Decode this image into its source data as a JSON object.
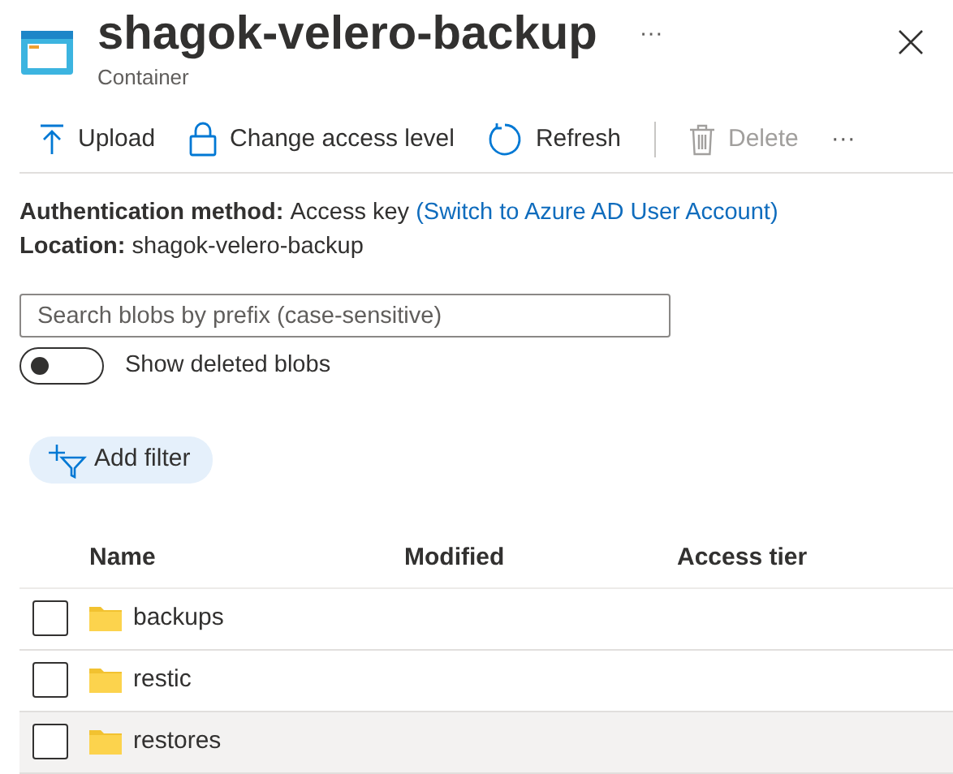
{
  "header": {
    "title": "shagok-velero-backup",
    "subtitle": "Container",
    "more": "···"
  },
  "toolbar": [
    {
      "kind": "upload",
      "label": "Upload",
      "disabled": false
    },
    {
      "kind": "lock",
      "label": "Change access level",
      "disabled": false
    },
    {
      "kind": "refresh",
      "label": "Refresh",
      "disabled": false
    },
    {
      "kind": "delete",
      "label": "Delete",
      "disabled": true
    },
    {
      "kind": "more",
      "label": "···",
      "disabled": false
    }
  ],
  "info": [
    {
      "label": "Authentication method:",
      "value": "Access key",
      "link": "(Switch to Azure AD User Account)"
    },
    {
      "label": "Location:",
      "value": "shagok-velero-backup"
    }
  ],
  "search": {
    "placeholder": "Search blobs by prefix (case-sensitive)"
  },
  "toggle": {
    "label": "Show deleted blobs",
    "on": false
  },
  "filter_button": "Add filter",
  "table": {
    "columns": [
      "Name",
      "Modified",
      "Access tier"
    ],
    "rows": [
      {
        "name": "backups",
        "checked": false,
        "highlighted": false
      },
      {
        "name": "restic",
        "checked": false,
        "highlighted": false
      },
      {
        "name": "restores",
        "checked": false,
        "highlighted": true
      }
    ]
  }
}
